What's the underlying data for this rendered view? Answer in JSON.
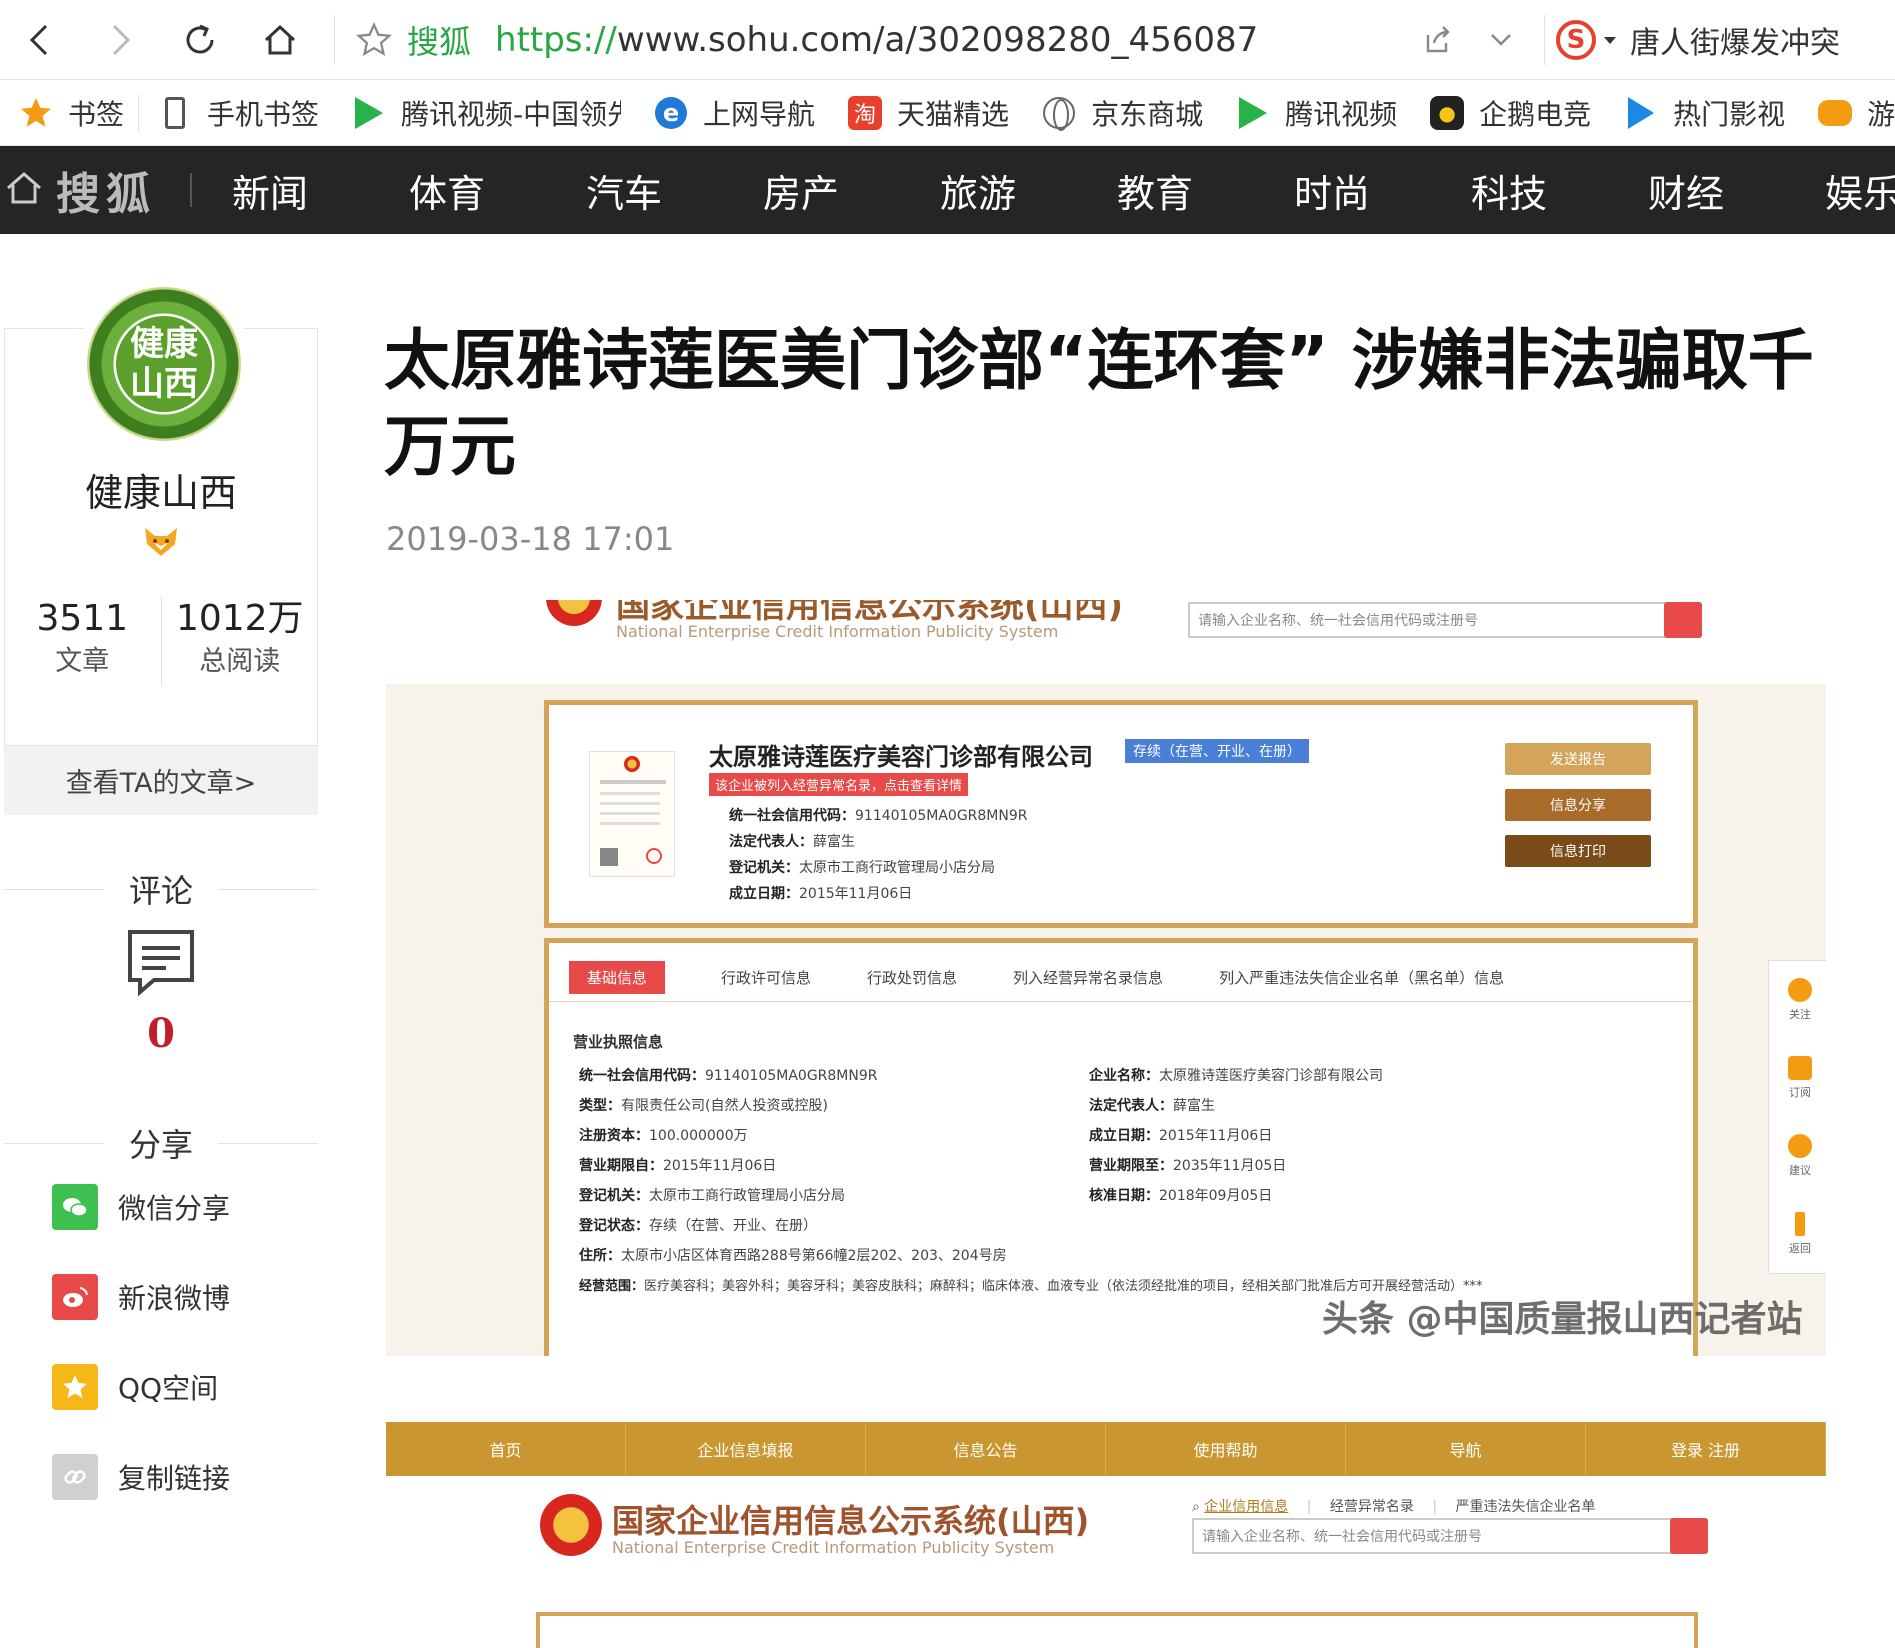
{
  "browser": {
    "site_name": "搜狐",
    "url_protocol": "https://",
    "url_rest": "www.sohu.com/a/302098280_456087",
    "hot_query": "唐人街爆发冲突",
    "icons": [
      "back-icon",
      "forward-icon",
      "reload-icon",
      "home-icon",
      "star-icon",
      "share-icon",
      "dropdown-icon",
      "sogou-icon"
    ]
  },
  "bookmarks": [
    {
      "label": "书签",
      "icon": "star-icon"
    },
    {
      "label": "手机书签",
      "icon": "phone-icon"
    },
    {
      "label": "腾讯视频-中国领先",
      "icon": "tencent-video-icon"
    },
    {
      "label": "上网导航",
      "icon": "ie-icon"
    },
    {
      "label": "天猫精选",
      "icon": "tmall-icon"
    },
    {
      "label": "京东商城",
      "icon": "globe-icon"
    },
    {
      "label": "腾讯视频",
      "icon": "tencent-video-icon"
    },
    {
      "label": "企鹅电竞",
      "icon": "penguin-icon"
    },
    {
      "label": "热门影视",
      "icon": "play-icon"
    },
    {
      "label": "游戏中",
      "icon": "gamepad-icon"
    }
  ],
  "channel_nav": {
    "logo": "搜狐",
    "items": [
      "新闻",
      "体育",
      "汽车",
      "房产",
      "旅游",
      "教育",
      "时尚",
      "科技",
      "财经",
      "娱乐"
    ]
  },
  "author": {
    "avatar_text_line1": "健康",
    "avatar_text_line2": "山西",
    "name": "健康山西",
    "articles_count": "3511",
    "articles_label": "文章",
    "reads_count": "1012万",
    "reads_label": "总阅读",
    "view_articles": "查看TA的文章>"
  },
  "comments": {
    "title": "评论",
    "count": "0"
  },
  "share": {
    "title": "分享",
    "items": [
      {
        "label": "微信分享",
        "color": "#3ec050"
      },
      {
        "label": "新浪微博",
        "color": "#e84a4a"
      },
      {
        "label": "QQ空间",
        "color": "#f5b818"
      },
      {
        "label": "复制链接",
        "color": "#cccccc"
      }
    ]
  },
  "article": {
    "title": "太原雅诗莲医美门诊部“连环套” 涉嫌非法骗取千万元",
    "date": "2019-03-18 17:01"
  },
  "shot1": {
    "system_name": "国家企业信用信息公示系统(山西)",
    "system_en": "National Enterprise Credit Information Publicity System",
    "search_placeholder": "请输入企业名称、统一社会信用代码或注册号",
    "company": "太原雅诗莲医疗美容门诊部有限公司",
    "status": "存续（在营、开业、在册）",
    "abnormal_tag": "该企业被列入经营异常名录，点击查看详情",
    "info": [
      {
        "k": "统一社会信用代码：",
        "v": "91140105MA0GR8MN9R"
      },
      {
        "k": "法定代表人：",
        "v": "薛富生"
      },
      {
        "k": "登记机关：",
        "v": "太原市工商行政管理局小店分局"
      },
      {
        "k": "成立日期：",
        "v": "2015年11月06日"
      }
    ],
    "buttons": [
      "发送报告",
      "信息分享",
      "信息打印"
    ],
    "tabs": [
      "基础信息",
      "行政许可信息",
      "行政处罚信息",
      "列入经营异常名录信息",
      "列入严重违法失信企业名单（黑名单）信息"
    ],
    "section": "营业执照信息",
    "left_rows": [
      {
        "k": "统一社会信用代码：",
        "v": "91140105MA0GR8MN9R"
      },
      {
        "k": "类型：",
        "v": "有限责任公司(自然人投资或控股)"
      },
      {
        "k": "注册资本：",
        "v": "100.000000万"
      },
      {
        "k": "营业期限自：",
        "v": "2015年11月06日"
      },
      {
        "k": "登记机关：",
        "v": "太原市工商行政管理局小店分局"
      },
      {
        "k": "登记状态：",
        "v": "存续（在营、开业、在册）"
      },
      {
        "k": "住所：",
        "v": "太原市小店区体育西路288号第66幢2层202、203、204号房"
      },
      {
        "k": "经营范围：",
        "v": "医疗美容科；美容外科；美容牙科；美容皮肤科；麻醉科；临床体液、血液专业（依法须经批准的项目，经相关部门批准后方可开展经营活动）***"
      }
    ],
    "right_rows": [
      {
        "k": "企业名称：",
        "v": "太原雅诗莲医疗美容门诊部有限公司"
      },
      {
        "k": "法定代表人：",
        "v": "薛富生"
      },
      {
        "k": "成立日期：",
        "v": "2015年11月06日"
      },
      {
        "k": "营业期限至：",
        "v": "2035年11月05日"
      },
      {
        "k": "核准日期：",
        "v": "2018年09月05日"
      }
    ],
    "watermark": "头条 @中国质量报山西记者站",
    "side_tools": [
      "关注",
      "订阅",
      "建议",
      "返回"
    ]
  },
  "shot2": {
    "nav": [
      "首页",
      "企业信息填报",
      "信息公告",
      "使用帮助",
      "导航",
      "登录 注册"
    ],
    "links": [
      "企业信用信息",
      "经营异常名录",
      "严重违法失信企业名单"
    ]
  }
}
